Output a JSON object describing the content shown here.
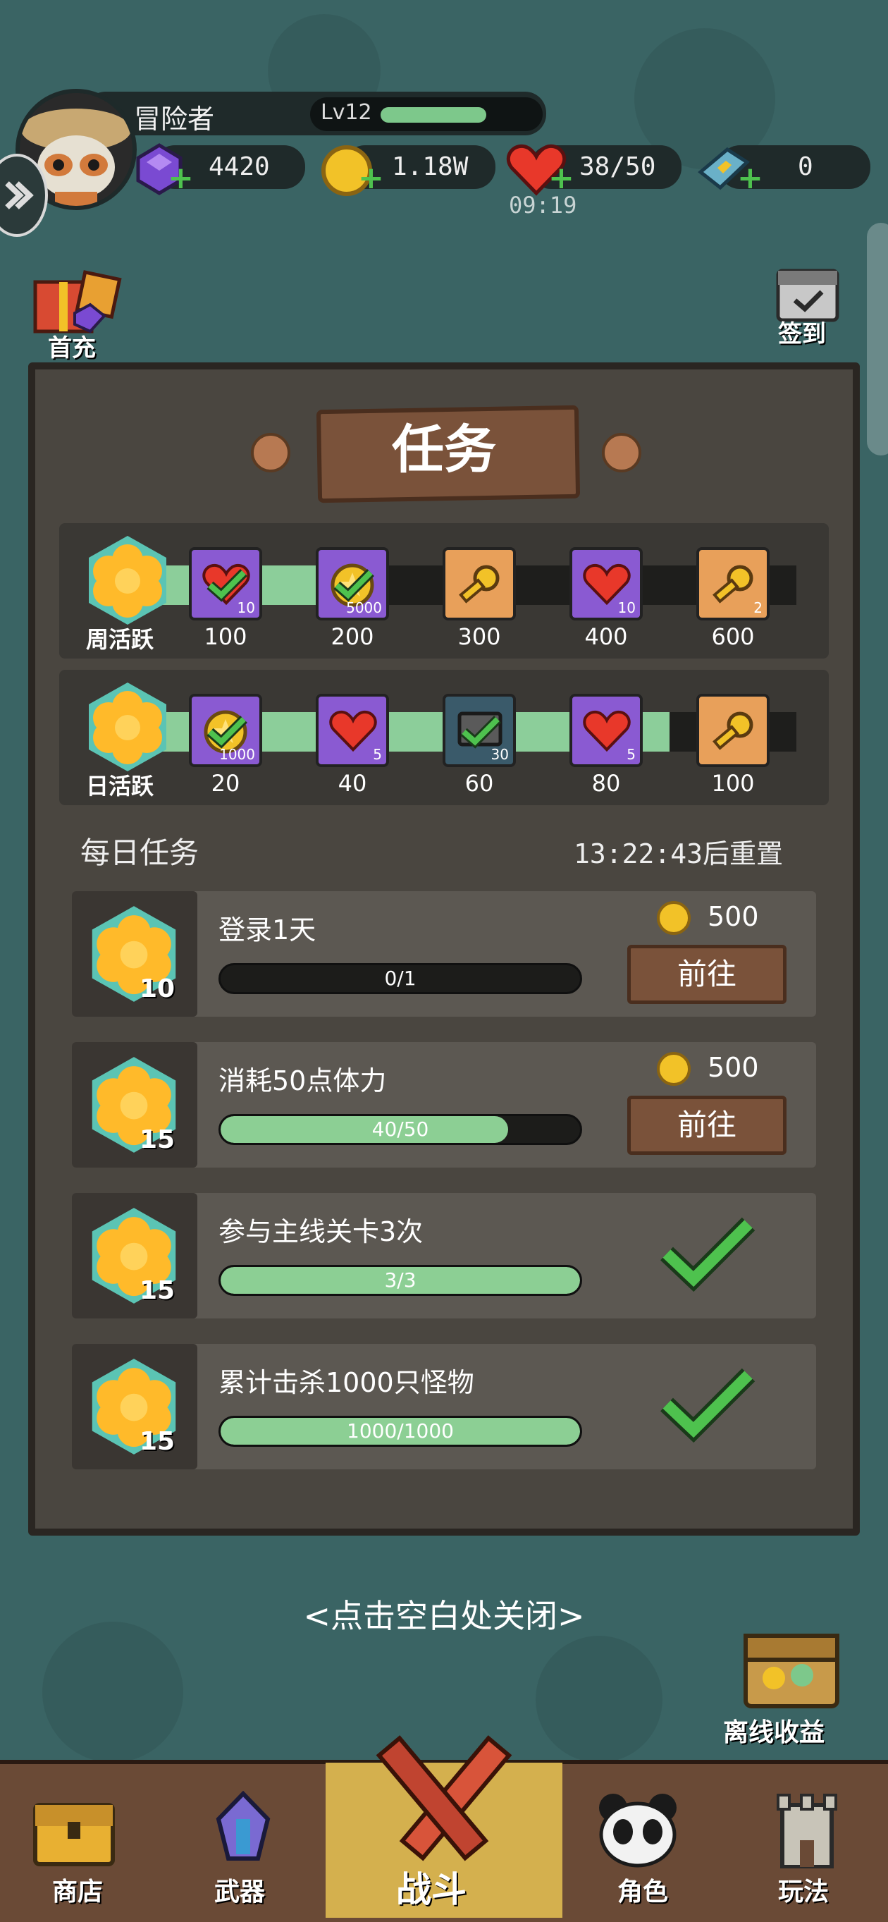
{
  "player": {
    "name": "冒险者",
    "level": "Lv12",
    "level_progress": 0.55
  },
  "resources": {
    "gems": "4420",
    "gold": "1.18W",
    "stamina": "38/50",
    "stamina_timer": "09:19",
    "tickets": "0"
  },
  "side_buttons": {
    "first_charge": "首充",
    "checkin": "签到"
  },
  "panel": {
    "title": "任务"
  },
  "weekly": {
    "label": "周活跃",
    "progress": 0.3,
    "milestones": [
      {
        "points": "100",
        "icon": "heart-icon",
        "count": "10",
        "claimed": true
      },
      {
        "points": "200",
        "icon": "coin-icon",
        "count": "5000",
        "claimed": true
      },
      {
        "points": "300",
        "icon": "key-icon",
        "count": "",
        "claimed": false
      },
      {
        "points": "400",
        "icon": "heart-icon",
        "count": "10",
        "claimed": false
      },
      {
        "points": "600",
        "icon": "key-icon",
        "count": "2",
        "claimed": false
      }
    ]
  },
  "daily": {
    "label": "日活跃",
    "progress": 0.8,
    "milestones": [
      {
        "points": "20",
        "icon": "coin-icon",
        "count": "1000",
        "claimed": true
      },
      {
        "points": "40",
        "icon": "heart-icon",
        "count": "5",
        "claimed": false
      },
      {
        "points": "60",
        "icon": "ticket-icon",
        "count": "30",
        "claimed": true
      },
      {
        "points": "80",
        "icon": "heart-icon",
        "count": "5",
        "claimed": false
      },
      {
        "points": "100",
        "icon": "key-icon",
        "count": "",
        "claimed": false
      }
    ]
  },
  "daily_tasks": {
    "heading": "每日任务",
    "reset": "13:22:43后重置",
    "goto_label": "前往",
    "items": [
      {
        "points": "10",
        "name": "登录1天",
        "progress_text": "0/1",
        "progress": 0.0,
        "reward": "500",
        "done": false
      },
      {
        "points": "15",
        "name": "消耗50点体力",
        "progress_text": "40/50",
        "progress": 0.8,
        "reward": "500",
        "done": false
      },
      {
        "points": "15",
        "name": "参与主线关卡3次",
        "progress_text": "3/3",
        "progress": 1.0,
        "reward": "",
        "done": true
      },
      {
        "points": "15",
        "name": "累计击杀1000只怪物",
        "progress_text": "1000/1000",
        "progress": 1.0,
        "reward": "",
        "done": true
      }
    ]
  },
  "close_hint": "<点击空白处关闭>",
  "offline": "离线收益",
  "nav": {
    "shop": "商店",
    "weapon": "武器",
    "battle": "战斗",
    "role": "角色",
    "play": "玩法"
  },
  "colors": {
    "bg": "#3a6464",
    "panel": "#4a4640",
    "green": "#8ccf94",
    "wood": "#7a523a"
  }
}
